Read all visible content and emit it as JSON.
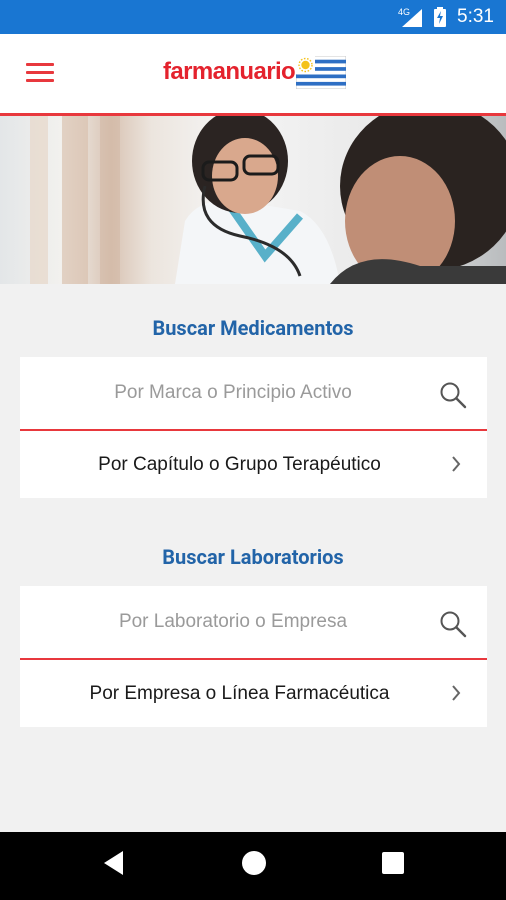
{
  "status_bar": {
    "network": "4G",
    "time": "5:31"
  },
  "app_bar": {
    "brand": "farmanuario",
    "menu_icon": "menu-icon",
    "flag_icon": "uruguay-flag-icon",
    "accent_color": "#e8383d",
    "brand_color": "#e4222d"
  },
  "medicamentos": {
    "title": "Buscar Medicamentos",
    "search_placeholder": "Por Marca o Principio Activo",
    "search_icon": "search-icon",
    "link_label": "Por Capítulo o Grupo Terapéutico",
    "link_icon": "chevron-right-icon"
  },
  "laboratorios": {
    "title": "Buscar Laboratorios",
    "search_placeholder": "Por Laboratorio o Empresa",
    "search_icon": "search-icon",
    "link_label": "Por Empresa o Línea Farmacéutica",
    "link_icon": "chevron-right-icon"
  },
  "colors": {
    "status_bar": "#1976d2",
    "title": "#2264a8",
    "background": "#f1f1f1"
  },
  "nav_bar": {
    "back_icon": "back-icon",
    "home_icon": "home-icon",
    "recents_icon": "recents-icon"
  }
}
